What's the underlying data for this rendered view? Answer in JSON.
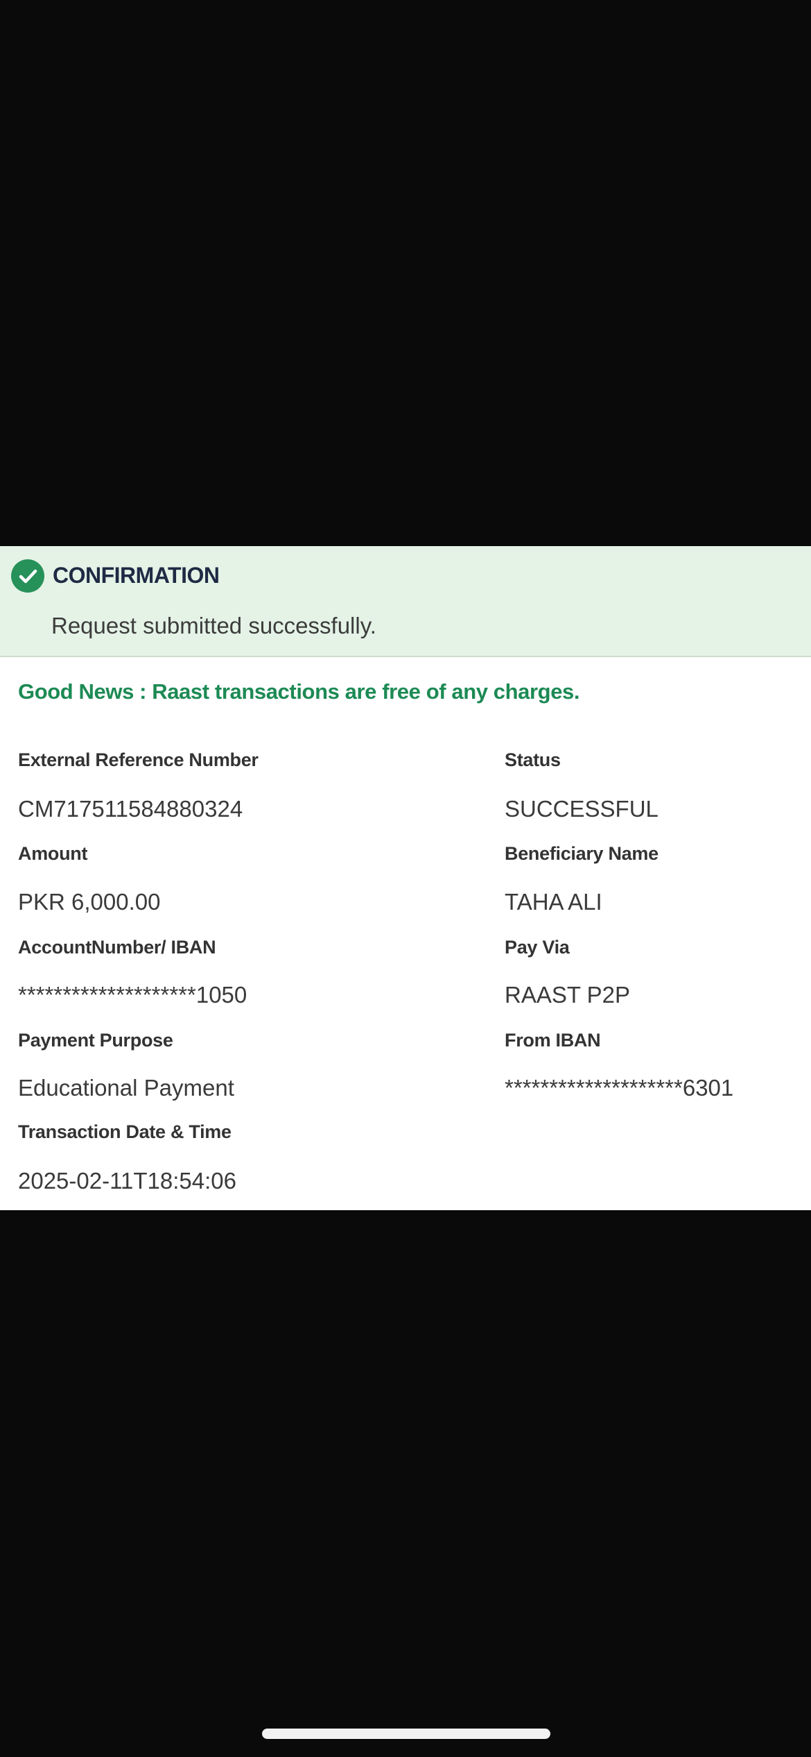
{
  "confirmation": {
    "title": "CONFIRMATION",
    "message": "Request submitted successfully.",
    "icon": "check-circle-icon",
    "color": "#27915a"
  },
  "good_news": "Good News : Raast transactions are free of any charges.",
  "fields": {
    "external_ref": {
      "label": "External Reference Number",
      "value": "CM717511584880324"
    },
    "status": {
      "label": "Status",
      "value": "SUCCESSFUL"
    },
    "amount": {
      "label": "Amount",
      "value": "PKR 6,000.00"
    },
    "beneficiary": {
      "label": "Beneficiary Name",
      "value": "TAHA ALI"
    },
    "account_iban": {
      "label": "AccountNumber/ IBAN",
      "value": "********************1050"
    },
    "pay_via": {
      "label": "Pay Via",
      "value": "RAAST P2P"
    },
    "purpose": {
      "label": "Payment Purpose",
      "value": "Educational Payment"
    },
    "from_iban": {
      "label": "From IBAN",
      "value": "********************6301"
    },
    "datetime": {
      "label": "Transaction Date & Time",
      "value": "2025-02-11T18:54:06"
    }
  }
}
